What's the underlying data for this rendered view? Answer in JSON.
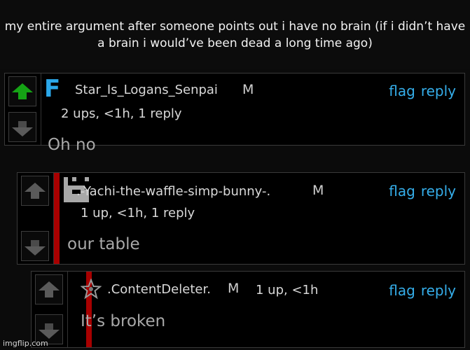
{
  "caption": "my entire argument after someone points out i have no brain (if i didn’t have a brain i would’ve been dead a long time ago)",
  "comments": [
    {
      "avatar_letter": "F",
      "avatar_color": "#2ba8ea",
      "username": "Star_Is_Logans_Senpai",
      "badge": "M",
      "meta": "2 ups, <1h, 1 reply",
      "text": "Oh no",
      "flag": "flag",
      "reply": "reply",
      "upvoted": true
    },
    {
      "username": ".-Yachi-the-waffle-simp-bunny-.",
      "badge": "M",
      "meta": "1 up, <1h, 1 reply",
      "text": "our table",
      "flag": "flag",
      "reply": "reply",
      "upvoted": false
    },
    {
      "username": ".ContentDeleter.",
      "badge": "M",
      "meta": "1 up, <1h",
      "text": "It’s broken",
      "flag": "flag",
      "reply": "reply",
      "upvoted": false
    }
  ],
  "watermark": "imgflip.com",
  "colors": {
    "link": "#35aeea",
    "upvote": "#15a315",
    "reply_bar": "#a80000"
  }
}
